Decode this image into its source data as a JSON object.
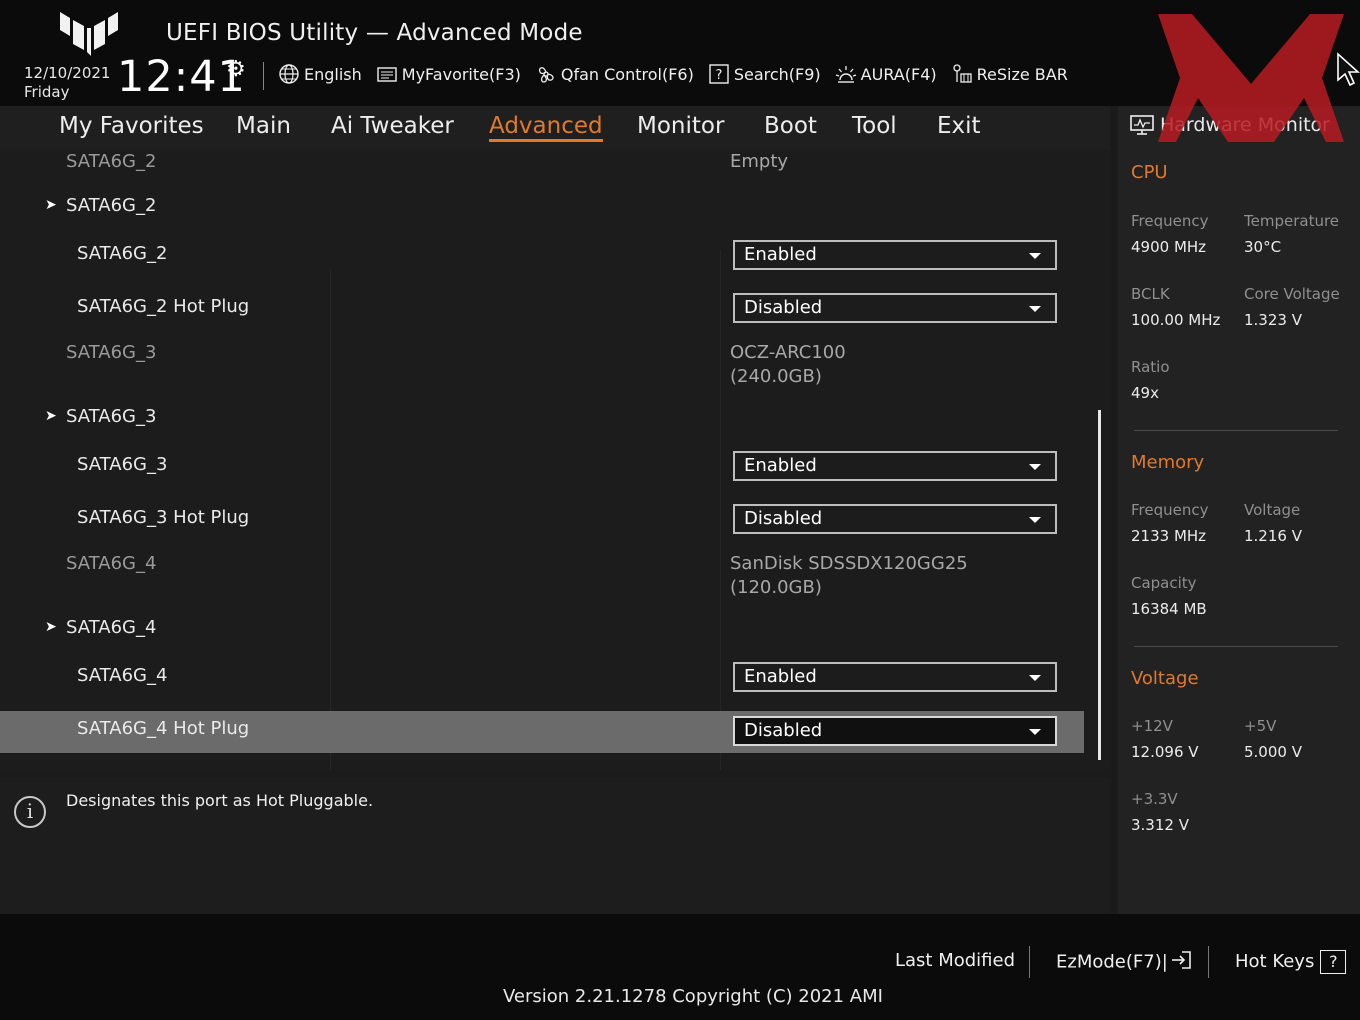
{
  "header": {
    "title": "UEFI BIOS Utility — Advanced Mode",
    "date": "12/10/2021",
    "day": "Friday",
    "time": "12:41",
    "toolbar": [
      {
        "label": "English",
        "icon": "globe-icon"
      },
      {
        "label": "MyFavorite(F3)",
        "icon": "favorite-icon"
      },
      {
        "label": "Qfan Control(F6)",
        "icon": "fan-icon"
      },
      {
        "label": "Search(F9)",
        "icon": "search-icon"
      },
      {
        "label": "AURA(F4)",
        "icon": "aura-icon"
      },
      {
        "label": "ReSize BAR",
        "icon": "resize-bar-icon"
      }
    ]
  },
  "nav": {
    "tabs": [
      "My Favorites",
      "Main",
      "Ai Tweaker",
      "Advanced",
      "Monitor",
      "Boot",
      "Tool",
      "Exit"
    ],
    "active": "Advanced"
  },
  "settings": {
    "rows": [
      {
        "label": "SATA6G_2",
        "value": "Empty"
      },
      {
        "label": "SATA6G_2"
      },
      {
        "label": "SATA6G_2",
        "value": "Enabled"
      },
      {
        "label": "SATA6G_2 Hot Plug",
        "value": "Disabled"
      },
      {
        "label": "SATA6G_3",
        "value": "OCZ-ARC100",
        "value2": "(240.0GB)"
      },
      {
        "label": "SATA6G_3"
      },
      {
        "label": "SATA6G_3",
        "value": "Enabled"
      },
      {
        "label": "SATA6G_3 Hot Plug",
        "value": "Disabled"
      },
      {
        "label": "SATA6G_4",
        "value": "SanDisk SDSSDX120GG25",
        "value2": "(120.0GB)"
      },
      {
        "label": "SATA6G_4"
      },
      {
        "label": "SATA6G_4",
        "value": "Enabled"
      },
      {
        "label": "SATA6G_4 Hot Plug",
        "value": "Disabled"
      }
    ]
  },
  "help": {
    "text": "Designates this port as Hot Pluggable."
  },
  "hardware_monitor": {
    "title": "Hardware Monitor",
    "cpu": {
      "heading": "CPU",
      "frequency_label": "Frequency",
      "frequency": "4900 MHz",
      "temperature_label": "Temperature",
      "temperature": "30°C",
      "bclk_label": "BCLK",
      "bclk": "100.00 MHz",
      "core_voltage_label": "Core Voltage",
      "core_voltage": "1.323 V",
      "ratio_label": "Ratio",
      "ratio": "49x"
    },
    "memory": {
      "heading": "Memory",
      "frequency_label": "Frequency",
      "frequency": "2133 MHz",
      "voltage_label": "Voltage",
      "voltage": "1.216 V",
      "capacity_label": "Capacity",
      "capacity": "16384 MB"
    },
    "voltage": {
      "heading": "Voltage",
      "v12_label": "+12V",
      "v12": "12.096 V",
      "v5_label": "+5V",
      "v5": "5.000 V",
      "v33_label": "+3.3V",
      "v33": "3.312 V"
    }
  },
  "footer": {
    "last_modified": "Last Modified",
    "ezmode": "EzMode(F7)|",
    "hotkeys": "Hot Keys",
    "hotkeys_key": "?",
    "version": "Version 2.21.1278 Copyright (C) 2021 AMI"
  },
  "colors": {
    "accent": "#e07a2e",
    "background": "#1b1b1b",
    "selected_row": "#6b6b6b"
  }
}
